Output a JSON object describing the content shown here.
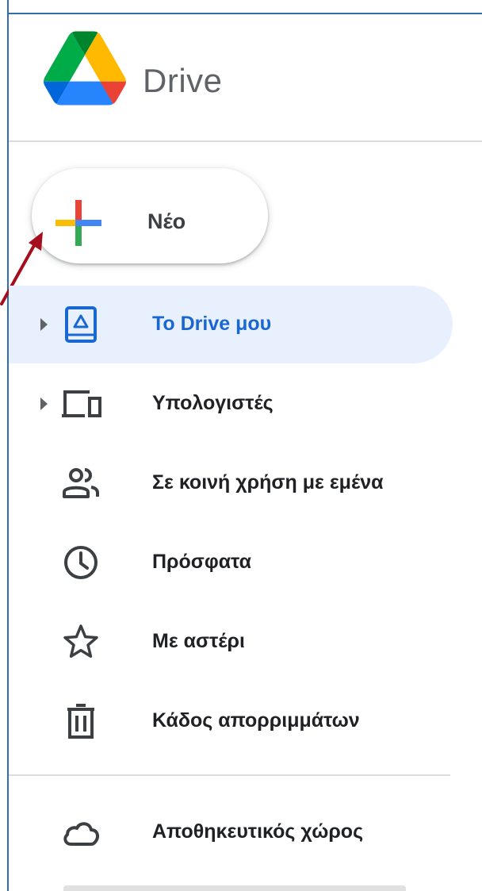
{
  "header": {
    "app_title": "Drive",
    "logo_icon": "google-drive-logo",
    "logo_colors": [
      "#0066da",
      "#00ac47",
      "#ea4335",
      "#00832d",
      "#2684fc",
      "#ffba00"
    ]
  },
  "new_button": {
    "label": "Νέο",
    "icon": "plus-icon",
    "plus_colors": {
      "top": "#ea4335",
      "right": "#4285f4",
      "bottom": "#34a853",
      "left": "#fbbc04"
    }
  },
  "annotation": {
    "arrow_color": "#a50e1c",
    "target": "new-button"
  },
  "nav": {
    "active_bg": "#e8f0fe",
    "active_color": "#1967d2",
    "items": [
      {
        "label": "Το Drive μου",
        "icon": "my-drive-icon",
        "expandable": true,
        "active": true
      },
      {
        "label": "Υπολογιστές",
        "icon": "computers-icon",
        "expandable": true,
        "active": false
      },
      {
        "label": "Σε κοινή χρήση με εμένα",
        "icon": "shared-with-me-icon",
        "expandable": false,
        "active": false
      },
      {
        "label": "Πρόσφατα",
        "icon": "clock-icon",
        "expandable": false,
        "active": false
      },
      {
        "label": "Με αστέρι",
        "icon": "star-icon",
        "expandable": false,
        "active": false
      },
      {
        "label": "Κάδος απορριμμάτων",
        "icon": "trash-icon",
        "expandable": false,
        "active": false
      }
    ],
    "storage": {
      "label": "Αποθηκευτικός χώρος",
      "icon": "cloud-icon"
    }
  }
}
